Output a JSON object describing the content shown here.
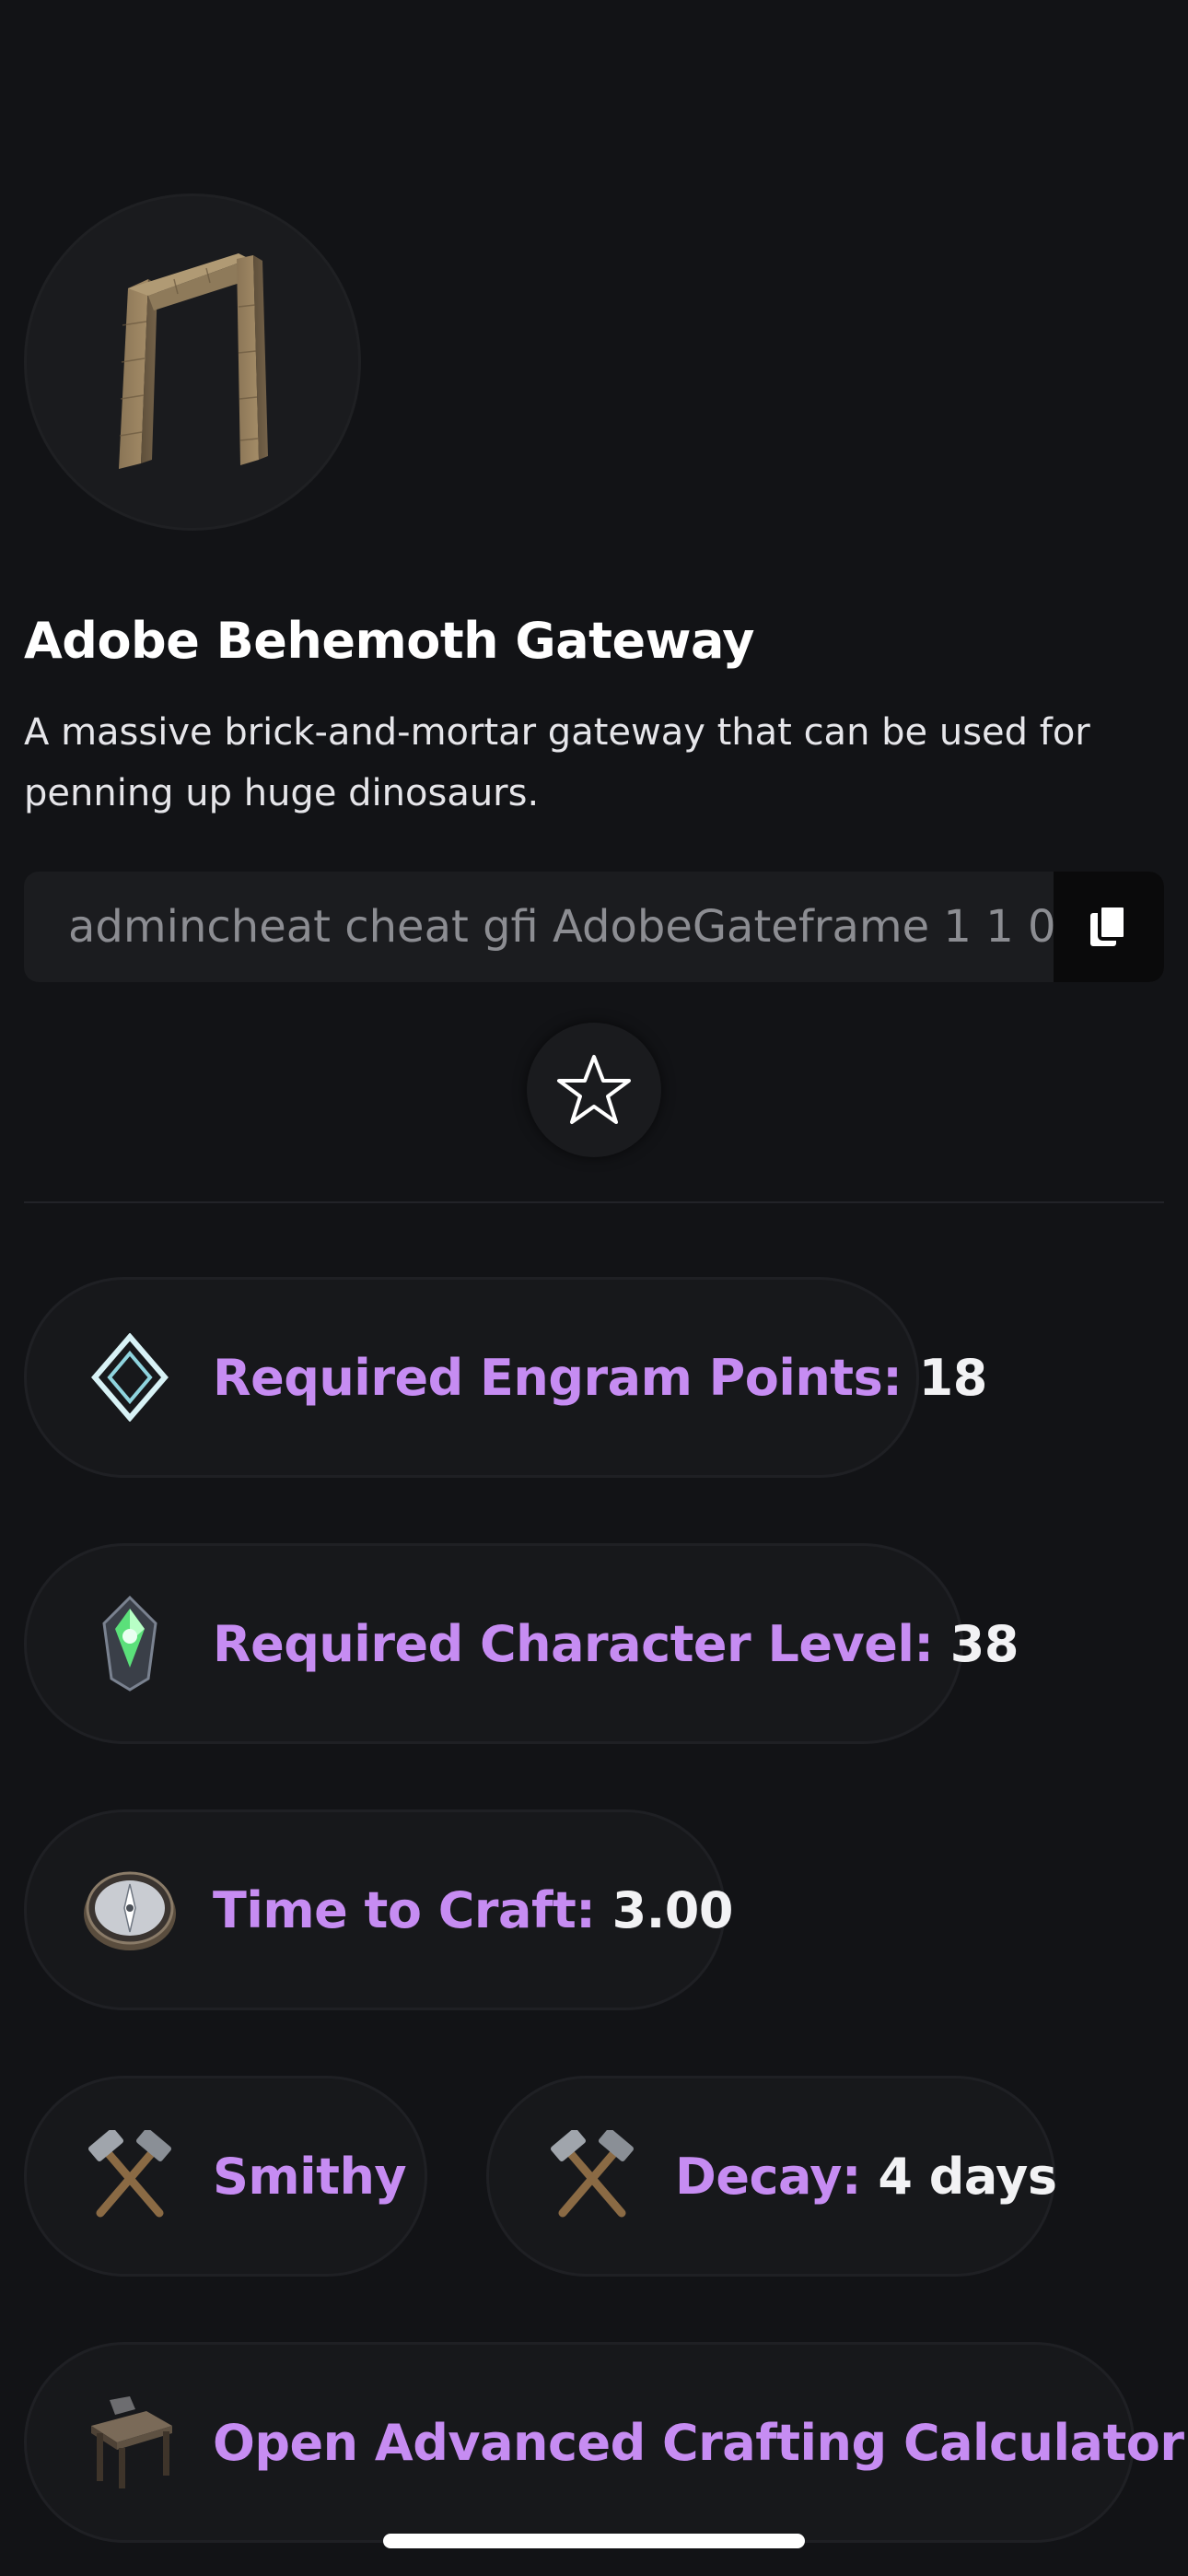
{
  "item": {
    "title": "Adobe Behemoth Gateway",
    "description": "A massive brick-and-mortar gateway that can be used for penning up huge dinosaurs.",
    "image_icon": "stone-gateway-icon"
  },
  "command": {
    "text": "admincheat cheat gfi AdobeGateframe 1 1 0",
    "copy_icon": "copy-icon"
  },
  "favorite": {
    "icon": "star-outline-icon"
  },
  "stats": {
    "engram_points": {
      "label": "Required Engram Points:",
      "value": "18",
      "icon": "engram-diamond-icon"
    },
    "character_level": {
      "label": "Required Character Level:",
      "value": "38",
      "icon": "level-crystal-icon"
    },
    "craft_time": {
      "label": "Time to Craft:",
      "value": "3.00",
      "icon": "compass-clock-icon"
    },
    "station": {
      "label": "Smithy",
      "icon": "crossed-hammers-icon"
    },
    "decay": {
      "label": "Decay:",
      "value": "4 days",
      "icon": "crossed-hammers-icon"
    },
    "calculator": {
      "label": "Open Advanced Crafting Calculator",
      "icon": "crafting-bench-icon"
    }
  },
  "colors": {
    "background": "#121316",
    "accent_label": "#c68cf2",
    "pill_background": "#17181b",
    "text_primary": "#f2f2f4"
  }
}
